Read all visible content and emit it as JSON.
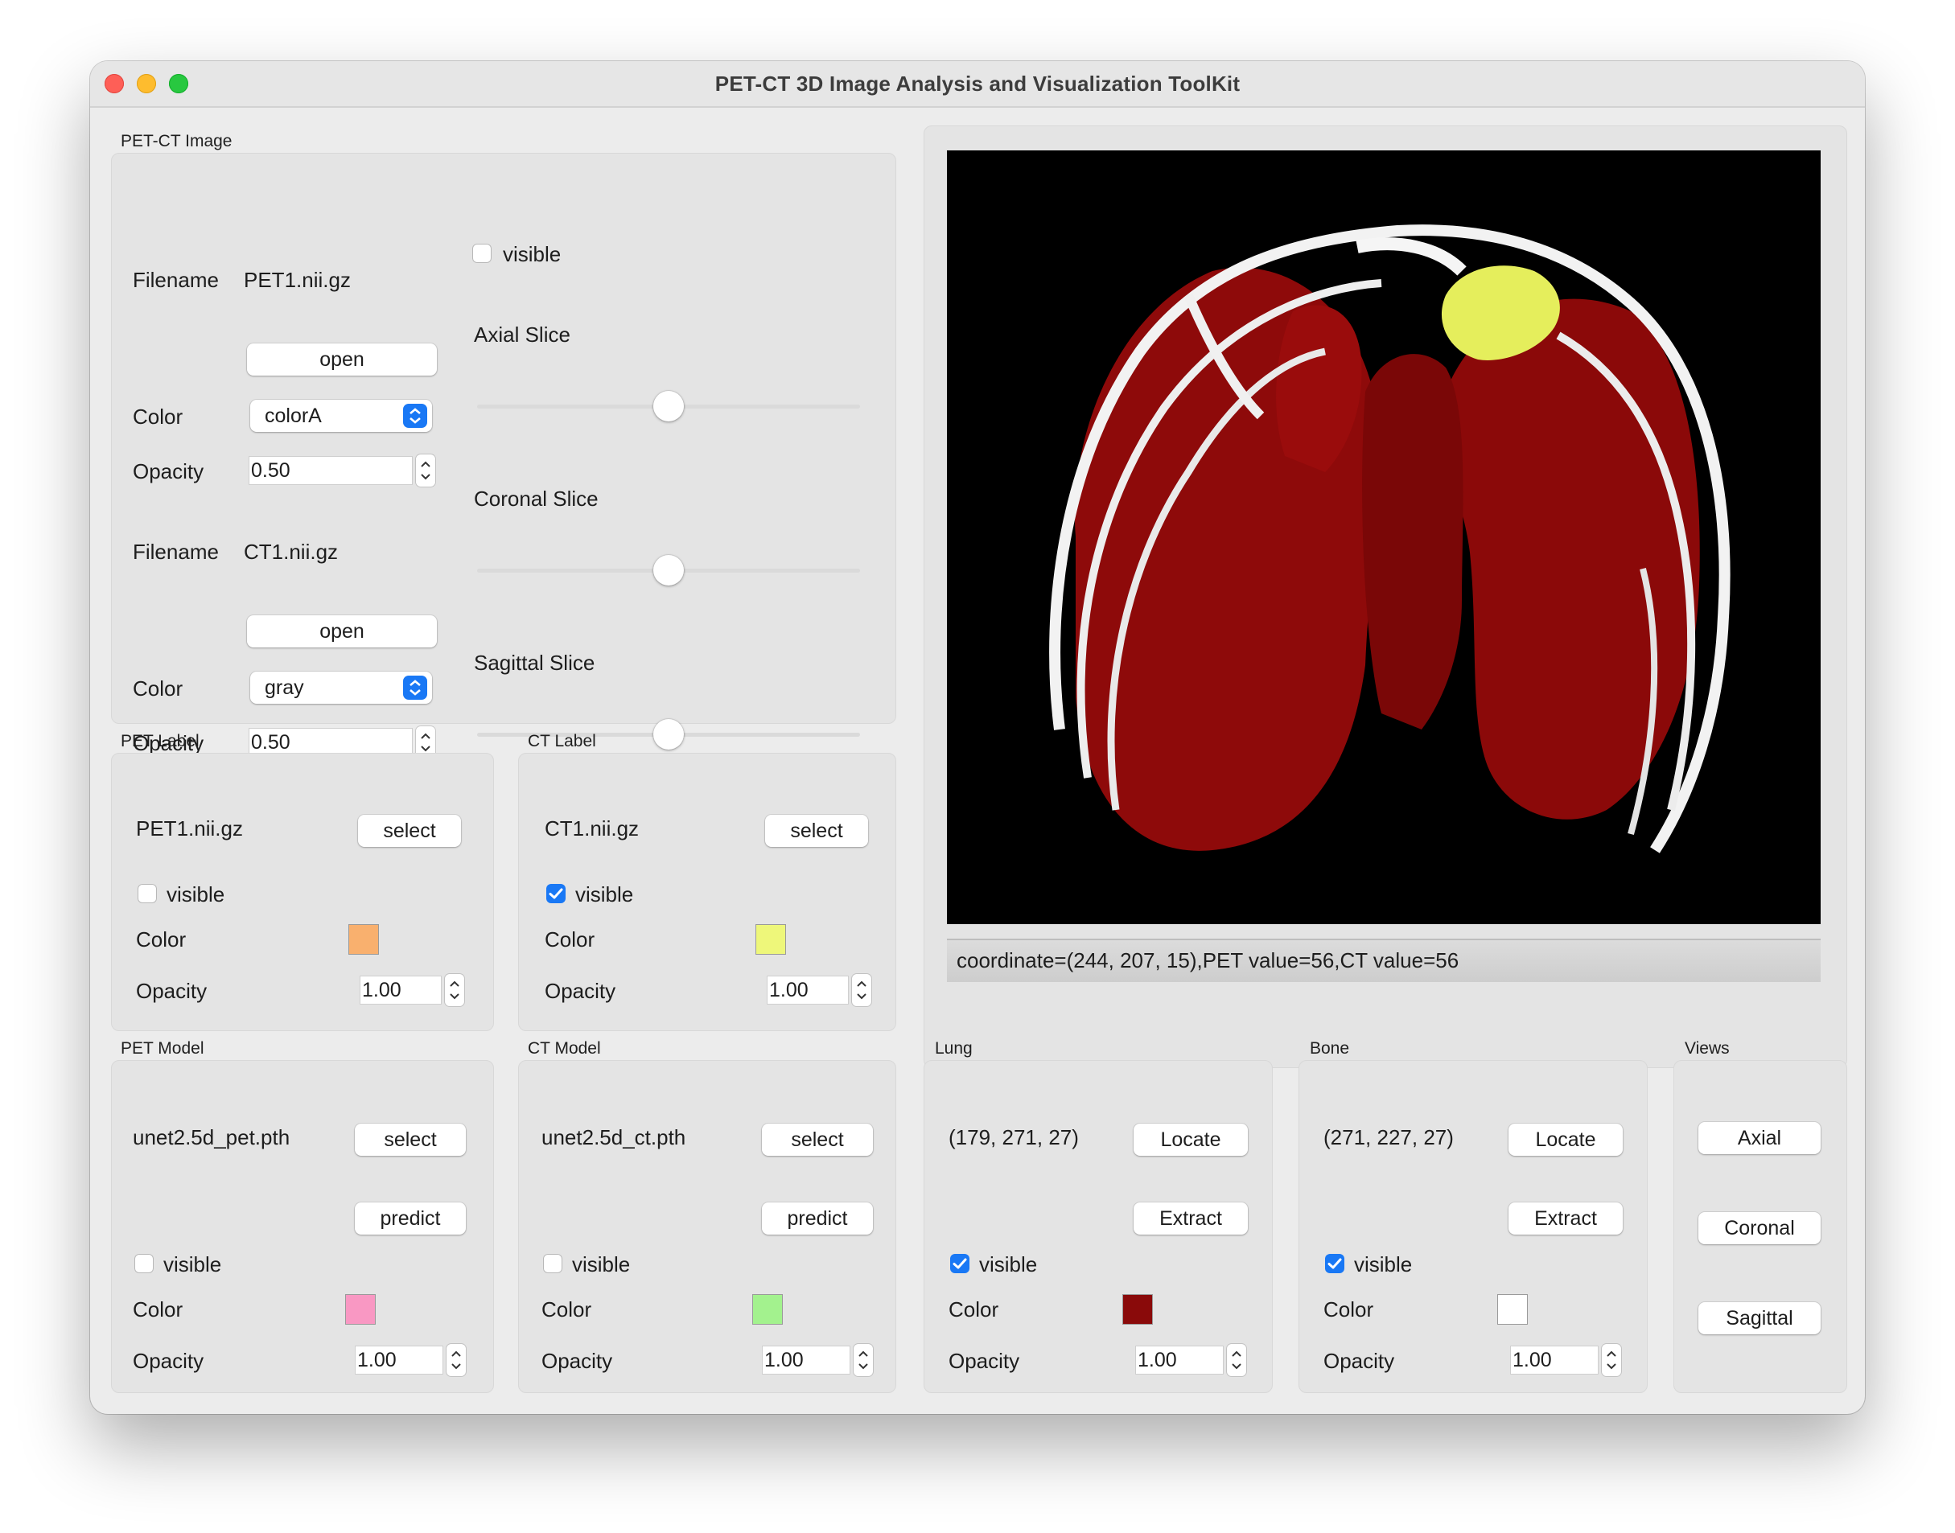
{
  "window": {
    "title": "PET-CT 3D Image Analysis and Visualization ToolKit"
  },
  "colors": {
    "close": "#fe5f57",
    "minimize": "#febc2e",
    "zoom": "#28c840",
    "accent": "#1978f5",
    "pet_label_color": "#f9b06e",
    "ct_label_color": "#eef77a",
    "pet_model_color": "#f998c3",
    "ct_model_color": "#a3f28e",
    "lung_color": "#8a0a0a",
    "bone_color": "#ffffff"
  },
  "image": {
    "group_label": "PET-CT Image",
    "pet": {
      "filename_label": "Filename",
      "filename": "PET1.nii.gz",
      "open_label": "open",
      "color_label": "Color",
      "color_value": "colorA",
      "opacity_label": "Opacity",
      "opacity": "0.50"
    },
    "ct": {
      "filename_label": "Filename",
      "filename": "CT1.nii.gz",
      "open_label": "open",
      "color_label": "Color",
      "color_value": "gray",
      "opacity_label": "Opacity",
      "opacity": "0.50"
    },
    "visible_label": "visible",
    "visible": false,
    "axial_label": "Axial Slice",
    "coronal_label": "Coronal Slice",
    "sagittal_label": "Sagittal Slice",
    "axial_level": 0.5,
    "coronal_level": 0.5,
    "sagittal_level": 0.5
  },
  "pet_label": {
    "group_label": "PET Label",
    "file": "PET1.nii.gz",
    "select_label": "select",
    "visible_label": "visible",
    "visible": false,
    "color_label": "Color",
    "opacity_label": "Opacity",
    "opacity": "1.00"
  },
  "ct_label": {
    "group_label": "CT Label",
    "file": "CT1.nii.gz",
    "select_label": "select",
    "visible_label": "visible",
    "visible": true,
    "color_label": "Color",
    "opacity_label": "Opacity",
    "opacity": "1.00"
  },
  "pet_model": {
    "group_label": "PET Model",
    "file": "unet2.5d_pet.pth",
    "select_label": "select",
    "predict_label": "predict",
    "visible_label": "visible",
    "visible": false,
    "color_label": "Color",
    "opacity_label": "Opacity",
    "opacity": "1.00"
  },
  "ct_model": {
    "group_label": "CT Model",
    "file": "unet2.5d_ct.pth",
    "select_label": "select",
    "predict_label": "predict",
    "visible_label": "visible",
    "visible": false,
    "color_label": "Color",
    "opacity_label": "Opacity",
    "opacity": "1.00"
  },
  "lung": {
    "group_label": "Lung",
    "coord": "(179, 271, 27)",
    "locate_label": "Locate",
    "extract_label": "Extract",
    "visible_label": "visible",
    "visible": true,
    "color_label": "Color",
    "opacity_label": "Opacity",
    "opacity": "1.00"
  },
  "bone": {
    "group_label": "Bone",
    "coord": "(271, 227, 27)",
    "locate_label": "Locate",
    "extract_label": "Extract",
    "visible_label": "visible",
    "visible": true,
    "color_label": "Color",
    "opacity_label": "Opacity",
    "opacity": "1.00"
  },
  "views": {
    "group_label": "Views",
    "axial": "Axial",
    "coronal": "Coronal",
    "sagittal": "Sagittal"
  },
  "viewer": {
    "status": "coordinate=(244, 207, 15),PET value=56,CT value=56"
  }
}
